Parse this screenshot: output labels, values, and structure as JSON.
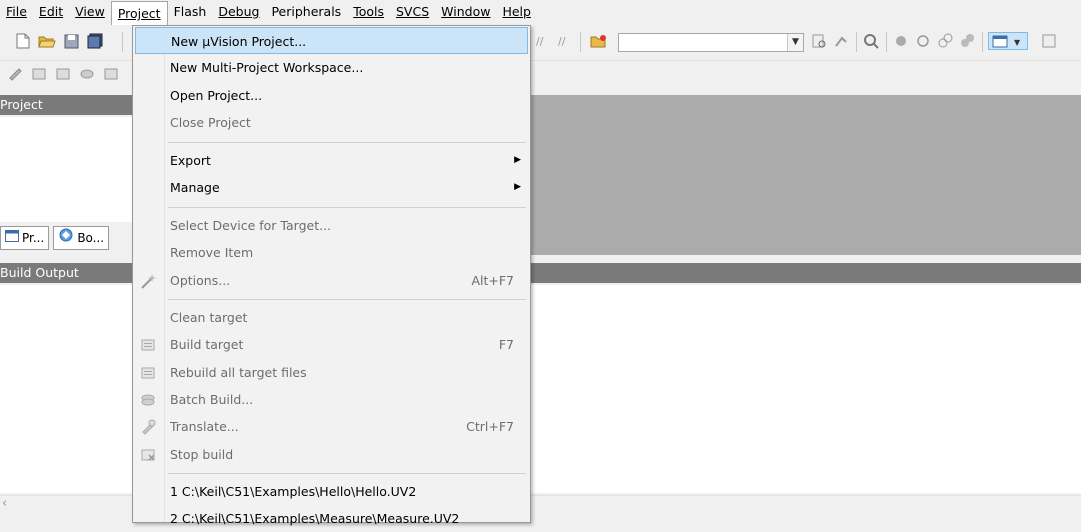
{
  "menubar": {
    "items": [
      "File",
      "Edit",
      "View",
      "Project",
      "Flash",
      "Debug",
      "Peripherals",
      "Tools",
      "SVCS",
      "Window",
      "Help"
    ],
    "active": "Project"
  },
  "panels": {
    "project_title": "Project",
    "build_output_title": "Build Output",
    "tabs": [
      "Pr...",
      "Bo..."
    ]
  },
  "project_menu": {
    "items": [
      {
        "label": "New µVision Project...",
        "shortcut": "",
        "submenu": false,
        "disabled": false,
        "highlighted": true
      },
      {
        "label": "New Multi-Project Workspace...",
        "shortcut": "",
        "submenu": false,
        "disabled": false
      },
      {
        "label": "Open Project...",
        "shortcut": "",
        "submenu": false,
        "disabled": false
      },
      {
        "label": "Close Project",
        "shortcut": "",
        "submenu": false,
        "disabled": true
      },
      {
        "label": "Export",
        "shortcut": "",
        "submenu": true,
        "disabled": false
      },
      {
        "label": "Manage",
        "shortcut": "",
        "submenu": true,
        "disabled": false
      },
      {
        "label": "Select Device for Target...",
        "shortcut": "",
        "submenu": false,
        "disabled": true
      },
      {
        "label": "Remove Item",
        "shortcut": "",
        "submenu": false,
        "disabled": true
      },
      {
        "label": "Options...",
        "shortcut": "Alt+F7",
        "submenu": false,
        "disabled": true,
        "icon": "options-wand-icon"
      },
      {
        "label": "Clean target",
        "shortcut": "",
        "submenu": false,
        "disabled": true
      },
      {
        "label": "Build target",
        "shortcut": "F7",
        "submenu": false,
        "disabled": true,
        "icon": "build-icon"
      },
      {
        "label": "Rebuild all target files",
        "shortcut": "",
        "submenu": false,
        "disabled": true,
        "icon": "rebuild-icon"
      },
      {
        "label": "Batch Build...",
        "shortcut": "",
        "submenu": false,
        "disabled": true,
        "icon": "batch-build-icon"
      },
      {
        "label": "Translate...",
        "shortcut": "Ctrl+F7",
        "submenu": false,
        "disabled": true,
        "icon": "translate-icon"
      },
      {
        "label": "Stop build",
        "shortcut": "",
        "submenu": false,
        "disabled": true,
        "icon": "stop-build-icon"
      },
      {
        "label": "1 C:\\Keil\\C51\\Examples\\Hello\\Hello.UV2",
        "shortcut": "",
        "submenu": false,
        "disabled": false
      },
      {
        "label": "2 C:\\Keil\\C51\\Examples\\Measure\\Measure.UV2",
        "shortcut": "",
        "submenu": false,
        "disabled": false
      }
    ]
  },
  "colors": {
    "highlight_bg": "#cce4f7",
    "highlight_border": "#7fb9e6",
    "panel_title_bg": "#7a7a7a",
    "workspace_gray": "#ababab"
  }
}
